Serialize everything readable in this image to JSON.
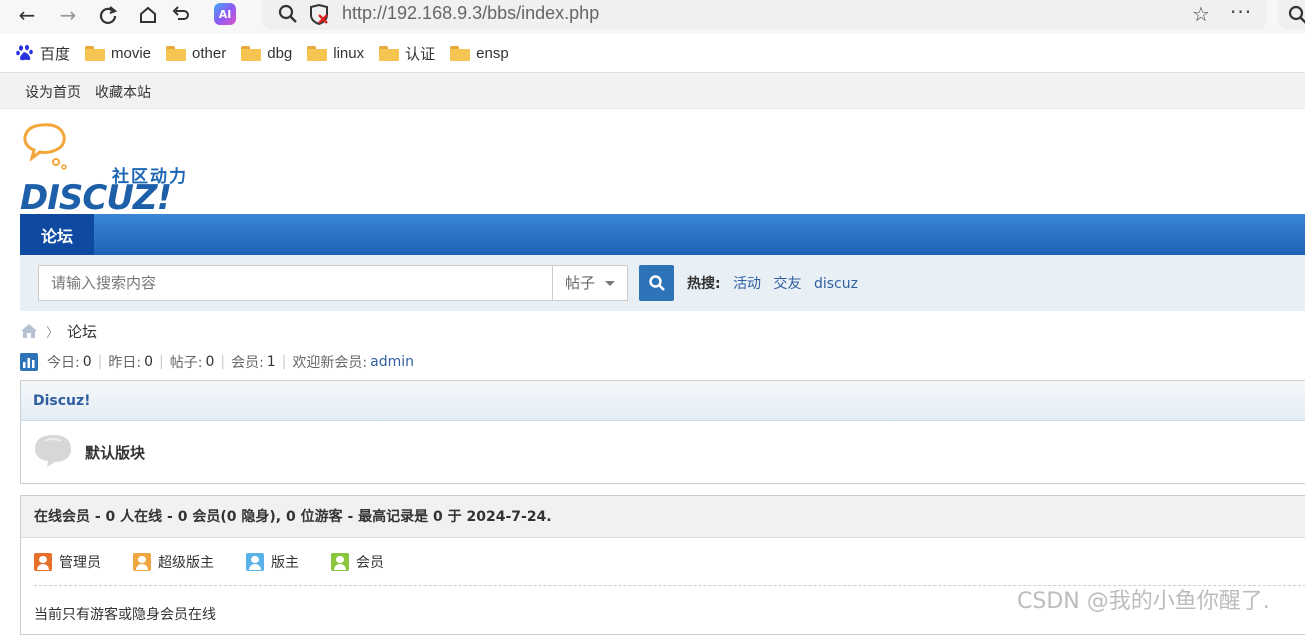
{
  "browser": {
    "url": "http://192.168.9.3/bbs/index.php",
    "ai_badge": "AI"
  },
  "bookmarks": [
    {
      "label": "百度",
      "icon": "baidu-icon"
    },
    {
      "label": "movie",
      "icon": "folder-icon"
    },
    {
      "label": "other",
      "icon": "folder-icon"
    },
    {
      "label": "dbg",
      "icon": "folder-icon"
    },
    {
      "label": "linux",
      "icon": "folder-icon"
    },
    {
      "label": "认证",
      "icon": "folder-icon"
    },
    {
      "label": "ensp",
      "icon": "folder-icon"
    }
  ],
  "topbar": {
    "set_home": "设为首页",
    "bookmark_site": "收藏本站"
  },
  "logo": {
    "cn": "社区动力",
    "en": "DISCUZ!"
  },
  "nav": {
    "active_tab": "论坛"
  },
  "search": {
    "placeholder": "请输入搜索内容",
    "type": "帖子",
    "hot_label": "热搜:",
    "hot_terms": [
      "活动",
      "交友",
      "discuz"
    ]
  },
  "breadcrumb": {
    "current": "论坛"
  },
  "stats": {
    "today_label": "今日:",
    "today": "0",
    "yesterday_label": "昨日:",
    "yesterday": "0",
    "posts_label": "帖子:",
    "posts": "0",
    "members_label": "会员:",
    "members": "1",
    "welcome_label": "欢迎新会员:",
    "newest_member": "admin"
  },
  "forum": {
    "category": "Discuz!",
    "board": "默认版块"
  },
  "online": {
    "header": "在线会员 - 0 人在线 - 0 会员(0 隐身), 0 位游客 - 最高记录是 0 于 2024-7-24.",
    "legend": [
      {
        "label": "管理员",
        "color": "#e8702a"
      },
      {
        "label": "超级版主",
        "color": "#f0a640"
      },
      {
        "label": "版主",
        "color": "#5ab3e8"
      },
      {
        "label": "会员",
        "color": "#8cc63f"
      }
    ],
    "note": "当前只有游客或隐身会员在线"
  },
  "watermark": "CSDN @我的小鱼你醒了."
}
